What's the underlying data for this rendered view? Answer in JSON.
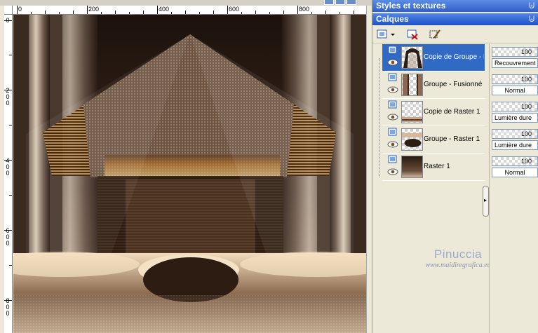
{
  "panels": {
    "styles_title": "Styles et textures",
    "layers_title": "Calques",
    "pin_glyph": "⨄"
  },
  "rulers": {
    "top_labels": [
      "0",
      "200",
      "400",
      "600",
      "800"
    ],
    "left_labels": [
      "0",
      "200",
      "400",
      "600",
      "800"
    ]
  },
  "layers": [
    {
      "name": "Copie de Groupe - F",
      "selected": true,
      "thumb_icon": "curtain-arch-icon",
      "opacity": "100",
      "blend": "Recouvrement"
    },
    {
      "name": "Groupe - Fusionné",
      "selected": false,
      "thumb_icon": "pillars-icon",
      "opacity": "100",
      "blend": "Normal"
    },
    {
      "name": "Copie de Raster 1",
      "selected": false,
      "thumb_icon": "floor-strip-icon",
      "opacity": "100",
      "blend": "Lumière dure"
    },
    {
      "name": "Groupe - Raster 1",
      "selected": false,
      "thumb_icon": "dark-oval-icon",
      "opacity": "100",
      "blend": "Lumière dure"
    },
    {
      "name": "Raster 1",
      "selected": false,
      "thumb_icon": "brown-gradient-icon",
      "opacity": "100",
      "blend": "Normal"
    }
  ],
  "watermark": {
    "line1": "Pinuccia",
    "line2": "www.maidiregrafica.eu"
  },
  "colors": {
    "selection": "#316ac5",
    "title_bar": "#2f5fc9",
    "panel_bg": "#ece9d8"
  }
}
